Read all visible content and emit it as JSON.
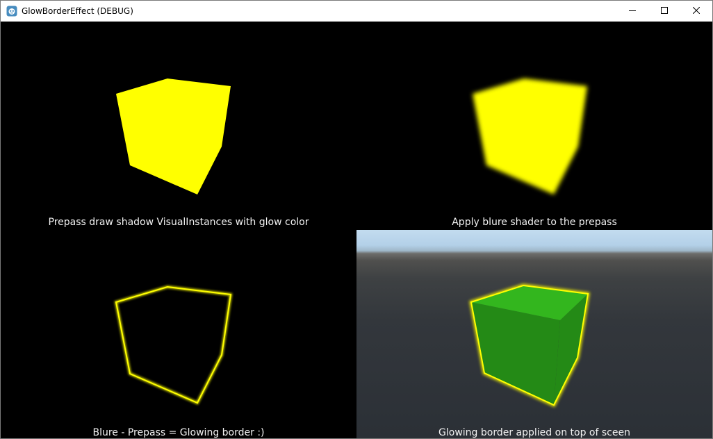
{
  "window": {
    "title": "GlowBorderEffect (DEBUG)",
    "icon": "godot-engine-icon",
    "controls": [
      "minimize-icon",
      "maximize-icon",
      "close-icon"
    ]
  },
  "panels": {
    "prepass": {
      "caption": "Prepass draw shadow VisualInstances with glow color"
    },
    "blur": {
      "caption": "Apply blure shader to the prepass"
    },
    "border": {
      "caption": "Blure - Prepass = Glowing border :)"
    },
    "final": {
      "caption": "Glowing border applied on top of sceen"
    }
  },
  "colors": {
    "glow": "#ffff00",
    "cube_top": "#33b61e",
    "cube_side": "#248a16",
    "background": "#000000"
  }
}
